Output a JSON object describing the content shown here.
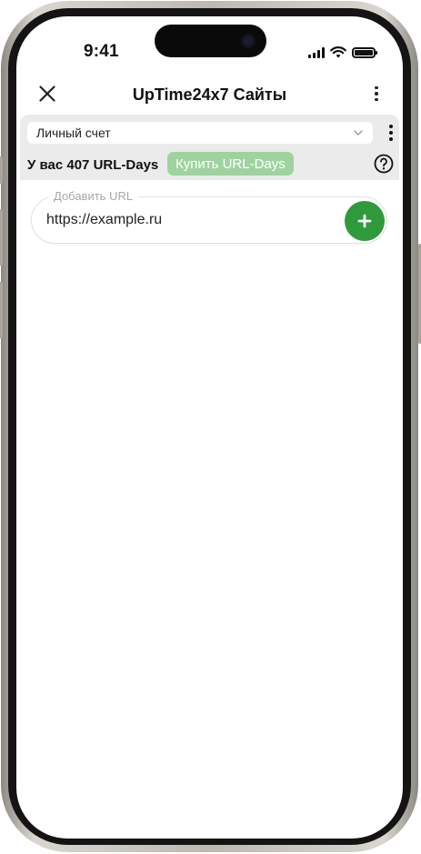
{
  "status_bar": {
    "time": "9:41",
    "icons": [
      "signal-icon",
      "wifi-icon",
      "battery-icon"
    ]
  },
  "header": {
    "title": "UpTime24x7 Сайты",
    "close_icon": "close-icon",
    "menu_icon": "more-vertical-icon"
  },
  "account": {
    "selected": "Личный счет",
    "balance": "У вас 407 URL-Days",
    "buy_label": "Купить URL-Days",
    "help_icon": "help-circle-icon"
  },
  "add_url": {
    "legend": "Добавить URL",
    "value": "https://example.ru",
    "add_icon": "plus-icon"
  },
  "colors": {
    "accent": "#2f9a3b",
    "buy_button": "#9ed3a0",
    "panel_bg": "#ebebeb"
  }
}
